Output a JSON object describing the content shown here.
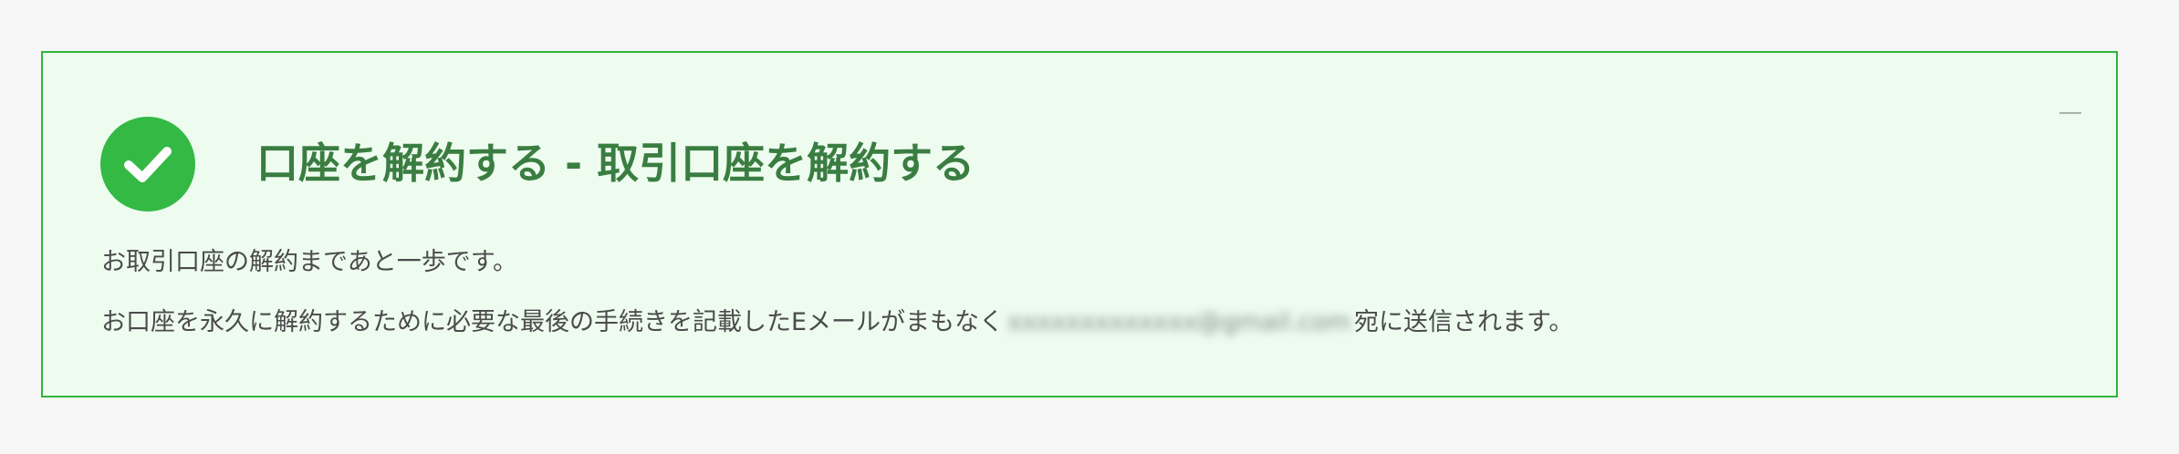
{
  "notice": {
    "status_icon": "check-circle-icon",
    "collapse_icon": "minus-icon",
    "title": "口座を解約する - 取引口座を解約する",
    "message_1": "お取引口座の解約まであと一歩です。",
    "message_2_before": "お口座を永久に解約するために必要な最後の手続きを記載したEメールがまもなく",
    "email_redacted": "xxxxxxxxxxxxx@gmail.com",
    "message_2_after": "宛に送信されます。",
    "colors": {
      "border": "#2fb53c",
      "background": "#eefcf0",
      "icon": "#34b944",
      "title": "#3a7d41"
    }
  }
}
